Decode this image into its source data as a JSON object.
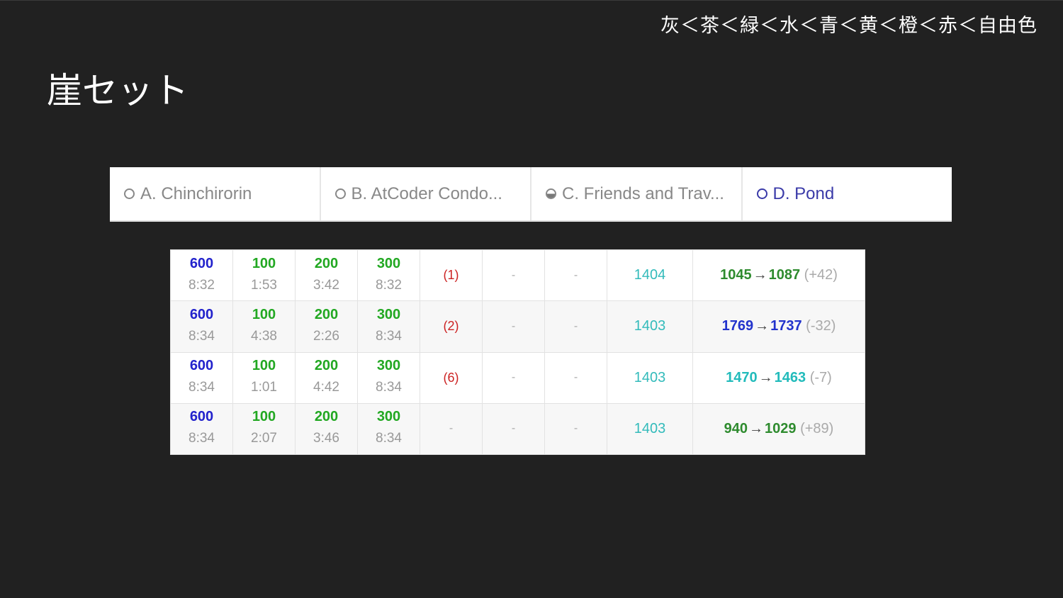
{
  "slide": {
    "rank_order": "灰＜茶＜緑＜水＜青＜黄＜橙＜赤＜自由色",
    "title": "崖セット"
  },
  "tabs": [
    {
      "label": "A. Chinchirorin",
      "icon": "circle-outline-icon",
      "active": false
    },
    {
      "label": "B. AtCoder Condo...",
      "icon": "circle-outline-icon",
      "active": false
    },
    {
      "label": "C. Friends and Trav...",
      "icon": "half-circle-icon",
      "active": false
    },
    {
      "label": "D. Pond",
      "icon": "circle-outline-icon",
      "active": true
    }
  ],
  "colors": {
    "background": "#212121",
    "score_blue": "#2222cc",
    "score_green": "#22a822",
    "penalty_red": "#cc2222",
    "performance_cyan": "#33bbbb",
    "rating_green": "#2e8b2e",
    "rating_blue": "#2233cc",
    "rating_cyan": "#22bbbb"
  },
  "standings": {
    "rows": [
      {
        "total_score": "600",
        "total_time": "8:32",
        "a_score": "100",
        "a_time": "1:53",
        "b_score": "200",
        "b_time": "3:42",
        "c_score": "300",
        "c_time": "8:32",
        "d": "(1)",
        "e": "-",
        "f": "-",
        "performance": "1404",
        "old_rating": "1045",
        "arrow": "→",
        "new_rating": "1087",
        "delta": "(+42)",
        "rating_color": "green"
      },
      {
        "total_score": "600",
        "total_time": "8:34",
        "a_score": "100",
        "a_time": "4:38",
        "b_score": "200",
        "b_time": "2:26",
        "c_score": "300",
        "c_time": "8:34",
        "d": "(2)",
        "e": "-",
        "f": "-",
        "performance": "1403",
        "old_rating": "1769",
        "arrow": "→",
        "new_rating": "1737",
        "delta": "(-32)",
        "rating_color": "blue"
      },
      {
        "total_score": "600",
        "total_time": "8:34",
        "a_score": "100",
        "a_time": "1:01",
        "b_score": "200",
        "b_time": "4:42",
        "c_score": "300",
        "c_time": "8:34",
        "d": "(6)",
        "e": "-",
        "f": "-",
        "performance": "1403",
        "old_rating": "1470",
        "arrow": "→",
        "new_rating": "1463",
        "delta": "(-7)",
        "rating_color": "cyan"
      },
      {
        "total_score": "600",
        "total_time": "8:34",
        "a_score": "100",
        "a_time": "2:07",
        "b_score": "200",
        "b_time": "3:46",
        "c_score": "300",
        "c_time": "8:34",
        "d": "-",
        "e": "-",
        "f": "-",
        "performance": "1403",
        "old_rating": "940",
        "arrow": "→",
        "new_rating": "1029",
        "delta": "(+89)",
        "rating_color": "green"
      }
    ]
  }
}
